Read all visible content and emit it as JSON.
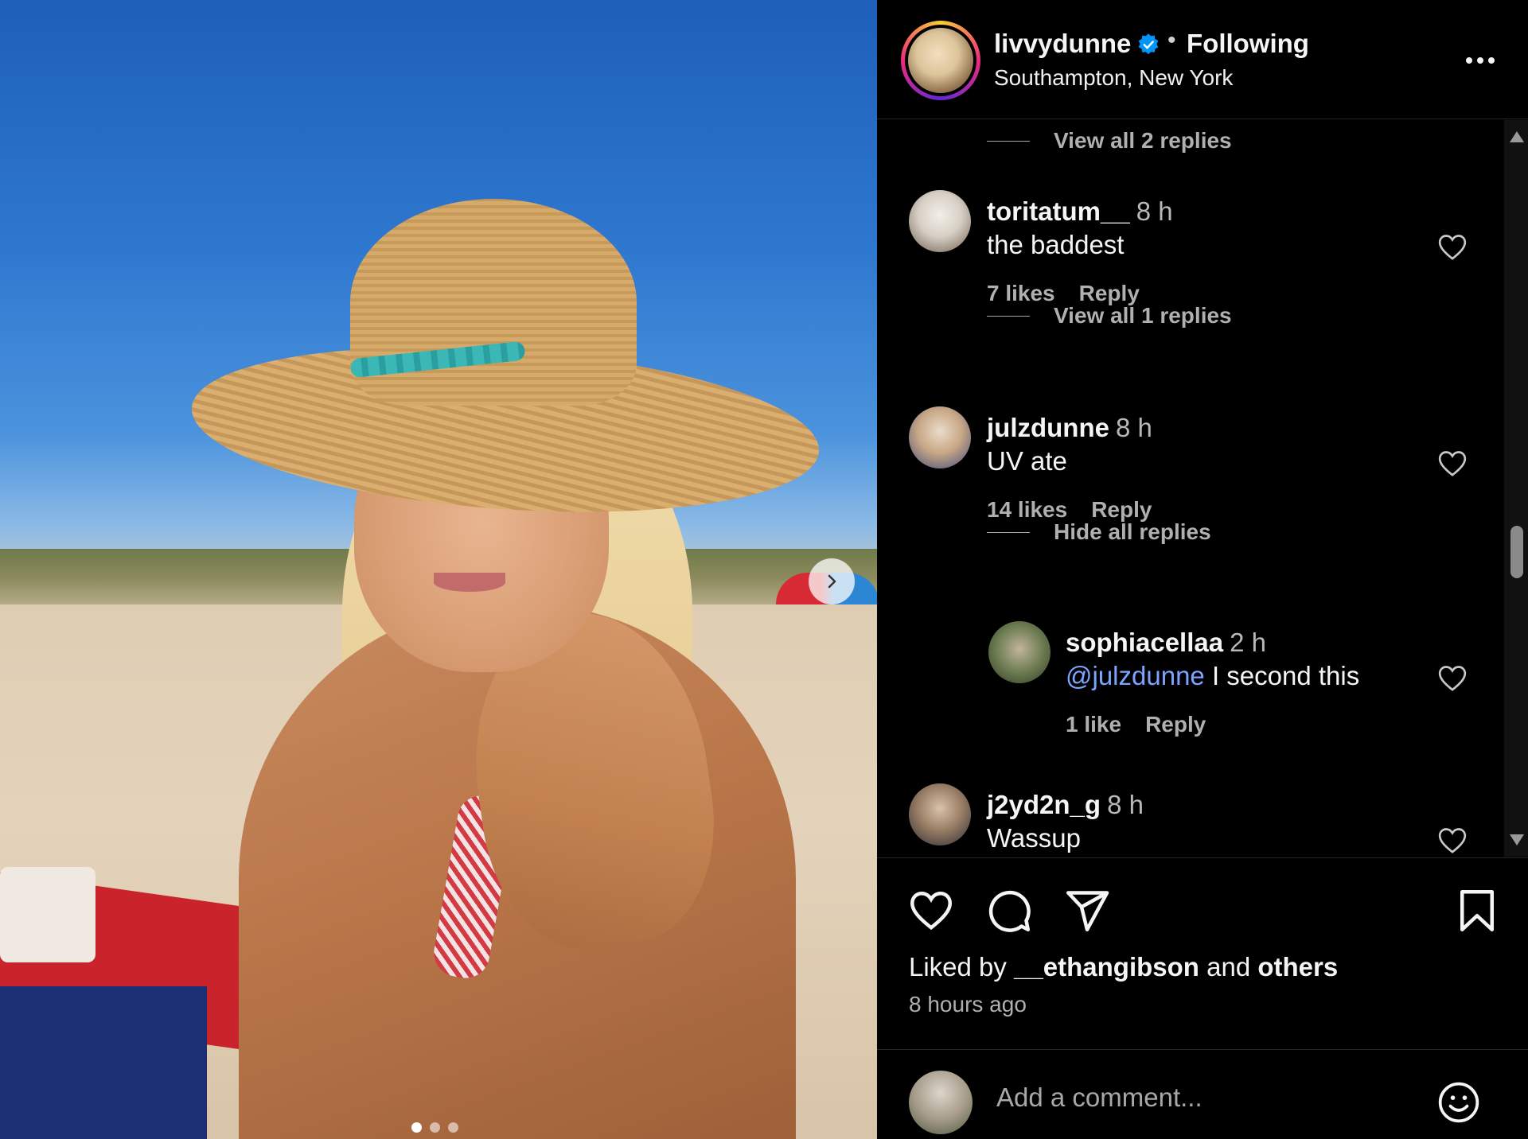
{
  "post": {
    "username": "livvydunne",
    "follow_status": "Following",
    "separator": "•",
    "location": "Southampton, New York"
  },
  "media": {
    "carousel_count": 3,
    "carousel_active_index": 0
  },
  "comments": {
    "view_replies_top": "View all 2 replies",
    "items": [
      {
        "username": "toritatum__",
        "time": "8 h",
        "text": "the baddest",
        "likes": "7 likes",
        "reply": "Reply"
      },
      {
        "username": "julzdunne",
        "time": "8 h",
        "text": "UV ate",
        "likes": "14 likes",
        "reply": "Reply"
      },
      {
        "username": "j2yd2n_g",
        "time": "8 h",
        "text": "Wassup"
      }
    ],
    "view_replies_mid": "View all 1 replies",
    "hide_replies": "Hide all replies",
    "reply": {
      "username": "sophiacellaa",
      "time": "2 h",
      "mention": "@julzdunne",
      "text": " I second this",
      "likes": "1 like",
      "reply": "Reply"
    }
  },
  "actions": {
    "liked_by_prefix": "Liked by",
    "liked_by_user": "__ethangibson",
    "liked_by_and": "and",
    "liked_by_others": "others",
    "time_ago": "8 hours ago"
  },
  "comment_box": {
    "placeholder": "Add a comment..."
  },
  "colors": {
    "background": "#000000",
    "text": "#f5f5f5",
    "muted": "#b0b0b0",
    "verified": "#0095f6",
    "mention": "#7ba3ff"
  },
  "icons": [
    "verified-badge-icon",
    "more-options-icon",
    "heart-icon",
    "comment-icon",
    "share-icon",
    "bookmark-icon",
    "emoji-icon",
    "chevron-right-icon"
  ]
}
